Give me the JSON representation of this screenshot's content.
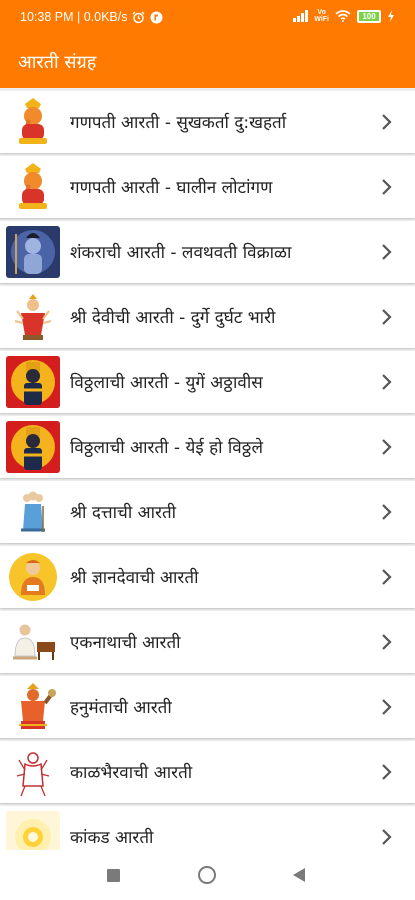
{
  "status": {
    "time_net": "10:38 PM | 0.0KB/s",
    "volte_top": "Vo",
    "volte_bottom": "WiFi",
    "battery": "100"
  },
  "toolbar": {
    "title": "आरती संग्रह"
  },
  "items": [
    {
      "label": "गणपती आरती - सुखकर्ता दु:खहर्ता",
      "icon": "ganpati-icon"
    },
    {
      "label": "गणपती आरती - घालीन लोटांगण",
      "icon": "ganpati-icon"
    },
    {
      "label": "शंकराची आरती - लवथवती विक्राळा",
      "icon": "shankar-icon"
    },
    {
      "label": "श्री देवीची आरती - दुर्गे दुर्घट भारी",
      "icon": "devi-icon"
    },
    {
      "label": "विठ्ठलाची आरती - युगें अठ्ठावीस",
      "icon": "vitthal-icon"
    },
    {
      "label": "विठ्ठलाची आरती - येई हो विठ्ठले",
      "icon": "vitthal-icon"
    },
    {
      "label": "श्री दत्ताची आरती",
      "icon": "datta-icon"
    },
    {
      "label": "श्री ज्ञानदेवाची आरती",
      "icon": "dnyaneshwar-icon"
    },
    {
      "label": "एकनाथाची आरती",
      "icon": "eknath-icon"
    },
    {
      "label": "हनुमंताची आरती",
      "icon": "hanuman-icon"
    },
    {
      "label": "काळभैरवाची आरती",
      "icon": "kalbhairav-icon"
    },
    {
      "label": "कांकड आरती",
      "icon": "kakad-icon"
    }
  ],
  "colors": {
    "accent": "#ff7a00",
    "chevron": "#555555"
  }
}
